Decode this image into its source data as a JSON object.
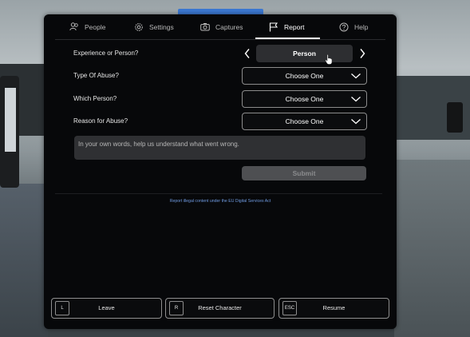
{
  "tabs": [
    {
      "label": "People",
      "icon": "people-icon"
    },
    {
      "label": "Settings",
      "icon": "gear-icon"
    },
    {
      "label": "Captures",
      "icon": "camera-icon"
    },
    {
      "label": "Report",
      "icon": "flag-icon",
      "active": true
    },
    {
      "label": "Help",
      "icon": "help-icon"
    }
  ],
  "report": {
    "experience_label": "Experience or Person?",
    "experience_value": "Person",
    "type_label": "Type Of Abuse?",
    "type_value": "Choose One",
    "person_label": "Which Person?",
    "person_value": "Choose One",
    "reason_label": "Reason for Abuse?",
    "reason_value": "Choose One",
    "comment_placeholder": "In your own words, help us understand what went wrong.",
    "submit_label": "Submit",
    "dsa_link": "Report illegal content under the EU Digital Services Act"
  },
  "bottom": [
    {
      "key": "L",
      "label": "Leave"
    },
    {
      "key": "R",
      "label": "Reset Character"
    },
    {
      "key": "ESC",
      "label": "Resume"
    }
  ],
  "colors": {
    "panel_bg": "#07080a",
    "active_tab": "#ffffff",
    "link": "#6f9ae0",
    "disabled_button": "#4e4f52"
  }
}
